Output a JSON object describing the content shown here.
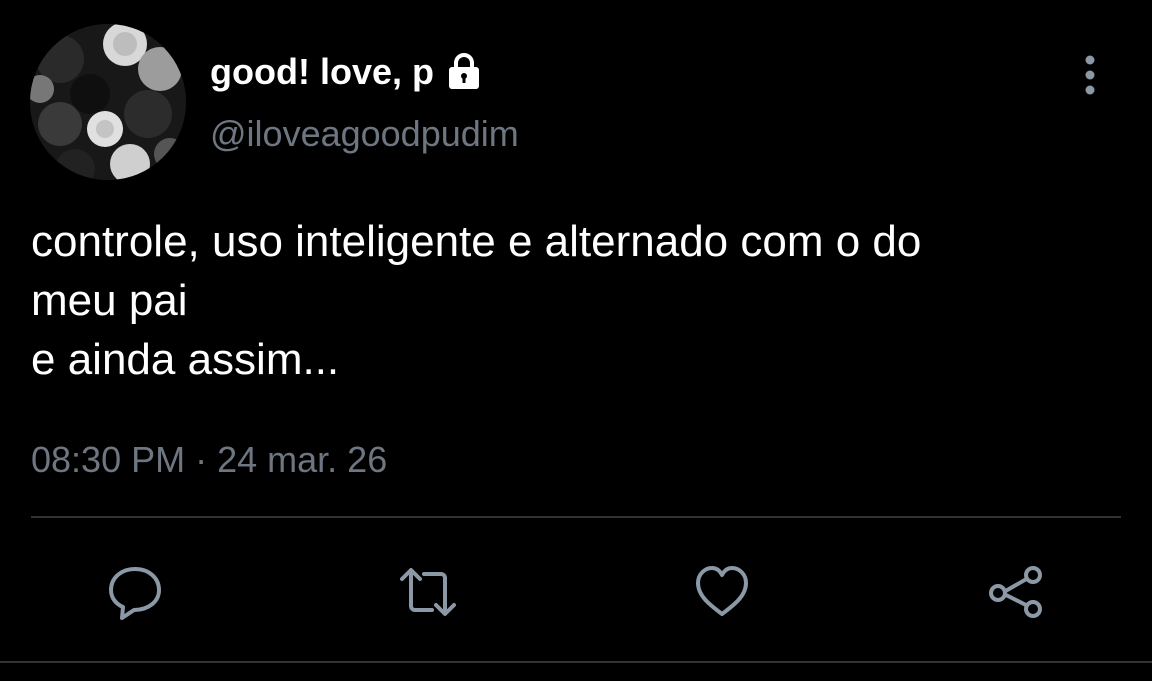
{
  "user": {
    "display_name": "good! love, p",
    "handle": "@iloveagoodpudim",
    "locked_icon": "lock-icon",
    "avatar_icon": "roses-avatar"
  },
  "tweet": {
    "lines": [
      "controle, uso inteligente e alternado com o do",
      "meu pai",
      "e ainda assim..."
    ],
    "time": "08:30 PM",
    "separator": "·",
    "date": "24 mar. 26"
  },
  "actions": [
    {
      "icon": "reply-icon"
    },
    {
      "icon": "retweet-icon"
    },
    {
      "icon": "like-icon"
    },
    {
      "icon": "share-icon"
    }
  ],
  "colors": {
    "background": "#000000",
    "text": "#ffffff",
    "muted": "#6e7681",
    "icon": "#8b98a5",
    "divider": "#2f3336"
  }
}
